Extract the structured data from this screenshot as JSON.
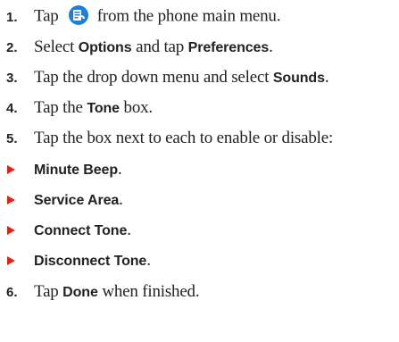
{
  "steps": [
    {
      "number": "1.",
      "parts": [
        "Tap",
        "from the phone main menu."
      ],
      "icon": "phone-app-icon"
    },
    {
      "number": "2.",
      "parts": [
        "Select ",
        "Options",
        " and tap ",
        "Preferences",
        "."
      ]
    },
    {
      "number": "3.",
      "parts": [
        "Tap the drop down menu and select ",
        "Sounds",
        "."
      ]
    },
    {
      "number": "4.",
      "parts": [
        "Tap the ",
        "Tone",
        " box."
      ]
    },
    {
      "number": "5.",
      "parts": [
        "Tap the box next to each to enable or disable:"
      ]
    }
  ],
  "options": [
    {
      "label": "Minute Beep",
      "suffix": "."
    },
    {
      "label": "Service Area",
      "suffix": "."
    },
    {
      "label": "Connect Tone",
      "suffix": "."
    },
    {
      "label": "Disconnect Tone",
      "suffix": "."
    }
  ],
  "final_step": {
    "number": "6.",
    "parts": [
      "Tap ",
      "Done",
      " when finished."
    ]
  },
  "colors": {
    "bullet": "#e2231a",
    "icon_blue": "#1e7fd6",
    "text": "#222222"
  }
}
